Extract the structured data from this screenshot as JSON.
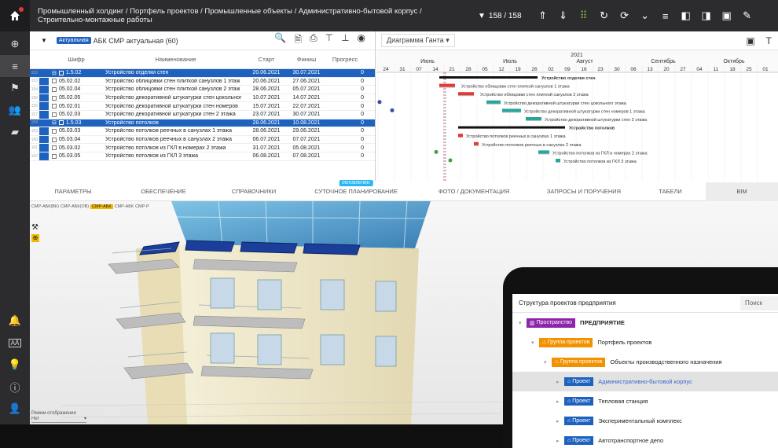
{
  "header": {
    "breadcrumb": "Промышленный холдинг / Портфель проектов / Промышленные объекты / Административно-бытовой корпус / Строительно-монтажные работы",
    "counter": "158 / 158"
  },
  "toolbar": {
    "badge": "Актуальная",
    "title": "АБК СМР актуальная (60)"
  },
  "table": {
    "headers": [
      "Шифр",
      "Наименование",
      "Старт",
      "Финиш",
      "Прогресс"
    ],
    "rows": [
      {
        "num": "152",
        "code": "1.5.02",
        "name": "Устройство отделки стен",
        "start": "20.06.2021",
        "finish": "30.07.2021",
        "progress": "0",
        "selected": true
      },
      {
        "num": "153",
        "code": "05.02.02",
        "name": "Устройство облицовки стен плиткой санузлов 1 этаж",
        "start": "20.06.2021",
        "finish": "27.06.2021",
        "progress": "0"
      },
      {
        "num": "154",
        "code": "05.02.04",
        "name": "Устройство облицовки стен плиткой санузлов 2 этаж",
        "start": "28.06.2021",
        "finish": "05.07.2021",
        "progress": "0"
      },
      {
        "num": "155",
        "code": "05.02.05",
        "name": "Устройство декоративной штукатурки стен цокольног",
        "start": "10.07.2021",
        "finish": "14.07.2021",
        "progress": "0"
      },
      {
        "num": "156",
        "code": "05.02.01",
        "name": "Устройство декоративной штукатурки стен номеров",
        "start": "15.07.2021",
        "finish": "22.07.2021",
        "progress": "0"
      },
      {
        "num": "157",
        "code": "05.02.03",
        "name": "Устройство декоративной штукатурки стен 2 этажа",
        "start": "23.07.2021",
        "finish": "30.07.2021",
        "progress": "0"
      },
      {
        "num": "158",
        "code": "1.5.03",
        "name": "Устройство потолков",
        "start": "28.06.2021",
        "finish": "10.08.2021",
        "progress": "0",
        "selected": true
      },
      {
        "num": "159",
        "code": "05.03.03",
        "name": "Устройство потолков реечных в санузлах 1 этажа",
        "start": "28.06.2021",
        "finish": "29.06.2021",
        "progress": "0"
      },
      {
        "num": "160",
        "code": "05.03.04",
        "name": "Устройство потолков реечных в санузлах 2 этажа",
        "start": "06.07.2021",
        "finish": "07.07.2021",
        "progress": "0"
      },
      {
        "num": "161",
        "code": "05.03.02",
        "name": "Устройство потолков из ГКЛ в номерах 2 этажа",
        "start": "31.07.2021",
        "finish": "05.08.2021",
        "progress": "0"
      },
      {
        "num": "162",
        "code": "05.03.05",
        "name": "Устройство потолков из ГКЛ 3 этажа",
        "start": "06.08.2021",
        "finish": "07.08.2021",
        "progress": "0"
      }
    ]
  },
  "gantt": {
    "select_label": "Диаграмма Ганта",
    "year": "2021",
    "months": [
      "Июнь",
      "Июль",
      "Август",
      "Сентябрь",
      "Октябрь"
    ],
    "days": [
      "24",
      "31",
      "07",
      "14",
      "21",
      "28",
      "05",
      "12",
      "19",
      "26",
      "02",
      "09",
      "16",
      "23",
      "30",
      "06",
      "13",
      "20",
      "27",
      "04",
      "11",
      "18",
      "25",
      "01"
    ],
    "labels": [
      "Устройство отделки стен",
      "Устройство облицовки стен плиткой санузлов 1 этажа",
      "Устройство облицовки стен плиткой санузлов 2 этажа",
      "Устройство декоративной штукатурки стен цокольного этажа",
      "Устройство декоративной штукатурки стен номеров 1 этажа",
      "Устройство декоративной штукатурки стен 2 этажа",
      "Устройство потолков",
      "Устройство потолков реечных в санузлах 1 этажа",
      "Устройство потолков реечных в санузлах 2 этажа",
      "Устройство потолков из ГКЛ в номерах 2 этажа",
      "Устройство потолков из ГКЛ 3 этажа"
    ]
  },
  "tabs": [
    "ПАРАМЕТРЫ",
    "ОБЕСПЕЧЕНИЕ",
    "СПРАВОЧНИКИ",
    "СУТОЧНОЕ ПЛАНИРОВАНИЕ",
    "ФОТО / ДОКУМЕНТАЦИЯ",
    "ЗАПРОСЫ И ПОРУЧЕНИЯ",
    "ТАБЕЛИ",
    "BIM"
  ],
  "tab_badge": "ОБНОВЛЕНИЕ!",
  "viewer": {
    "model_tabs": [
      "СМР-АБК(ВК)",
      "СМР-АБК(ОВ)",
      "СМР-АБК",
      "СМР-АБК",
      "СМР-Р"
    ],
    "view_mode_label": "Режим отображения",
    "view_mode_value": "Нет"
  },
  "tablet": {
    "title": "Структура проектов предприятия",
    "search": "Поиск",
    "tree": [
      {
        "tag": "Пространство",
        "label": "ПРЕДПРИЯТИЕ"
      },
      {
        "tag": "Группа проектов",
        "label": "Портфель проектов"
      },
      {
        "tag": "Группа проектов",
        "label": "Объекты производственного назначения"
      },
      {
        "tag": "Проект",
        "label": "Административно-бытовой корпус"
      },
      {
        "tag": "Проект",
        "label": "Тепловая станция"
      },
      {
        "tag": "Проект",
        "label": "Экспериментальный комплекс"
      },
      {
        "tag": "Проект",
        "label": "Автотранспортное депо"
      }
    ]
  }
}
